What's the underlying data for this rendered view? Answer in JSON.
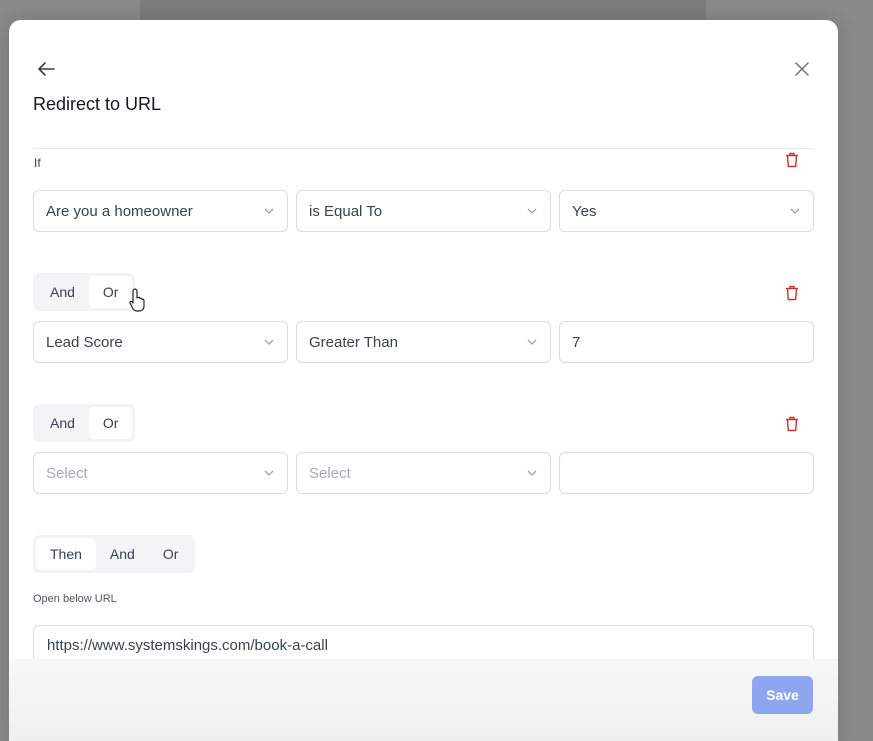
{
  "modal": {
    "title": "Redirect to URL"
  },
  "conditions": {
    "if_label": "If",
    "rows": [
      {
        "field": "Are you a homeowner",
        "operator": "is Equal To",
        "value": "Yes"
      },
      {
        "field": "Lead Score",
        "operator": "Greater Than",
        "value": "7"
      },
      {
        "field": "Select",
        "operator": "Select",
        "value": ""
      }
    ],
    "connectors": [
      {
        "options": [
          "And",
          "Or"
        ],
        "selected": "Or"
      },
      {
        "options": [
          "And",
          "Or"
        ],
        "selected": "Or"
      }
    ]
  },
  "then": {
    "options": [
      "Then",
      "And",
      "Or"
    ],
    "selected": "Then",
    "url_label": "Open below URL",
    "url_value": "https://www.systemskings.com/book-a-call"
  },
  "footer": {
    "save_label": "Save"
  },
  "colors": {
    "accent": "#8ea6f0",
    "delete": "#c0392b"
  },
  "icons": {
    "back": "arrow-left-icon",
    "close": "close-icon",
    "delete": "trash-icon",
    "dropdown": "chevron-down-icon",
    "cursor": "hand-pointer-icon"
  }
}
